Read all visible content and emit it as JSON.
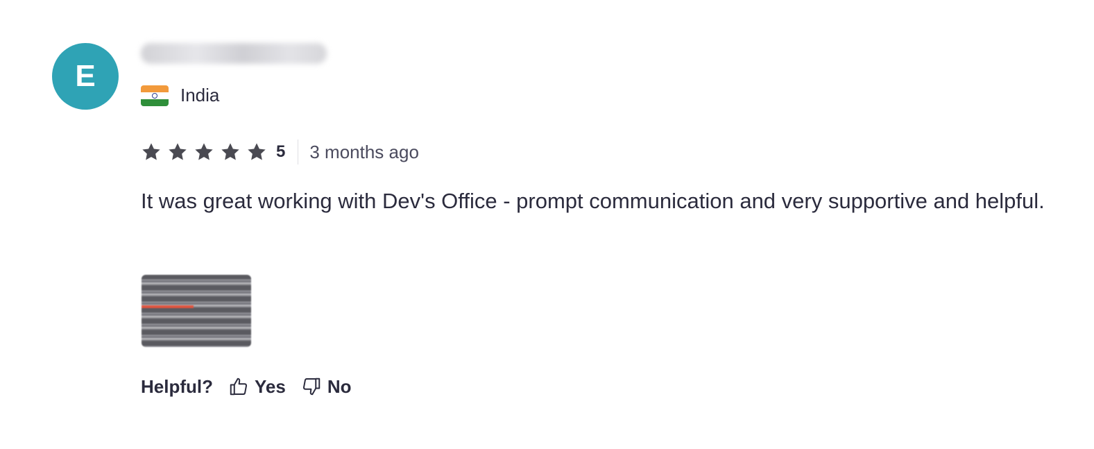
{
  "reviewer": {
    "avatar_initial": "E",
    "avatar_color": "#2fa3b5",
    "country": "India",
    "flag_icon": "india-flag-icon"
  },
  "review": {
    "rating": "5",
    "star_count": 5,
    "time": "3 months ago",
    "text": "It was great working with Dev's Office - prompt communication and very supportive and helpful."
  },
  "feedback": {
    "label": "Helpful?",
    "yes_label": "Yes",
    "no_label": "No",
    "yes_icon": "thumbs-up-icon",
    "no_icon": "thumbs-down-icon"
  },
  "colors": {
    "star": "#4a4a52",
    "text": "#2b2b3d"
  }
}
